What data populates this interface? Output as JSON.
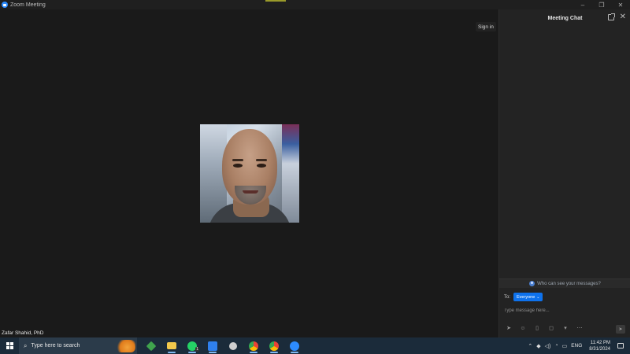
{
  "window": {
    "title": "Zoom Meeting",
    "controls": [
      "–",
      "❐",
      "✕"
    ]
  },
  "main": {
    "sign_in_label": "Sign in",
    "participant_name": "Zafar Shahid, PhD"
  },
  "chat": {
    "title": "Meeting Chat",
    "who_can_see": "Who can see your messages?",
    "to_label": "To:",
    "recipient": "Everyone",
    "message_placeholder": "Type message here...",
    "tools": [
      "format-icon",
      "emoji-icon",
      "file-icon",
      "screenshot-icon",
      "more-icon"
    ]
  },
  "taskbar": {
    "search_placeholder": "Type here to search",
    "apps": [
      {
        "name": "stack-app-icon",
        "color": "#3fa34d"
      },
      {
        "name": "file-explorer-icon",
        "color": "#f2c94c"
      },
      {
        "name": "whatsapp-icon",
        "color": "#25d366",
        "badge": "1"
      },
      {
        "name": "news-app-icon",
        "color": "#2f80ed"
      },
      {
        "name": "settings-icon",
        "color": "#cfcfcf"
      },
      {
        "name": "chrome-icon",
        "color": "#ea4335"
      },
      {
        "name": "chrome-alt-icon",
        "color": "#ea4335"
      },
      {
        "name": "zoom-icon",
        "color": "#2d8cff"
      }
    ],
    "language": "ENG",
    "time": "11:42 PM",
    "date": "8/31/2024"
  },
  "colors": {
    "zoom_blue": "#0e72ed",
    "taskbar_bg": "#1b2b3a",
    "chat_bg": "#232323",
    "main_bg": "#1a1a1a"
  }
}
